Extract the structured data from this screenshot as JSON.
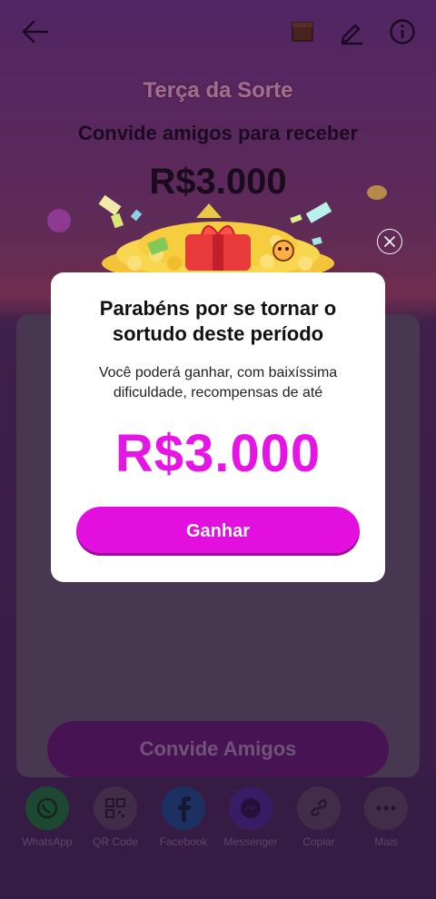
{
  "header": {
    "back_icon": "arrow-left-icon",
    "calendar_icon": "calendar-icon",
    "edit_icon": "edit-icon",
    "info_icon": "info-icon"
  },
  "background": {
    "event_title": "Terça da Sorte",
    "invite_text": "Convide amigos para receber",
    "amount": "R$3.000",
    "invite_button": "Convide Amigos"
  },
  "share": {
    "items": [
      {
        "label": "WhatsApp",
        "icon": "whatsapp-icon",
        "color": "#1d7a3a"
      },
      {
        "label": "QR Code",
        "icon": "qr-code-icon",
        "color": "#5d4a67"
      },
      {
        "label": "Facebook",
        "icon": "facebook-icon",
        "color": "#1d4f92"
      },
      {
        "label": "Messenger",
        "icon": "messenger-icon",
        "color": "#4b2c9a"
      },
      {
        "label": "Copiar",
        "icon": "link-icon",
        "color": "#5d4a67"
      },
      {
        "label": "Mais",
        "icon": "more-icon",
        "color": "#5d4a67"
      }
    ]
  },
  "modal": {
    "title": "Parabéns por se tornar o sortudo deste período",
    "subtitle": "Você poderá ganhar, com baixíssima dificuldade, recompensas de até",
    "amount": "R$3.000",
    "button": "Ganhar",
    "accent_color": "#e20fdf"
  }
}
